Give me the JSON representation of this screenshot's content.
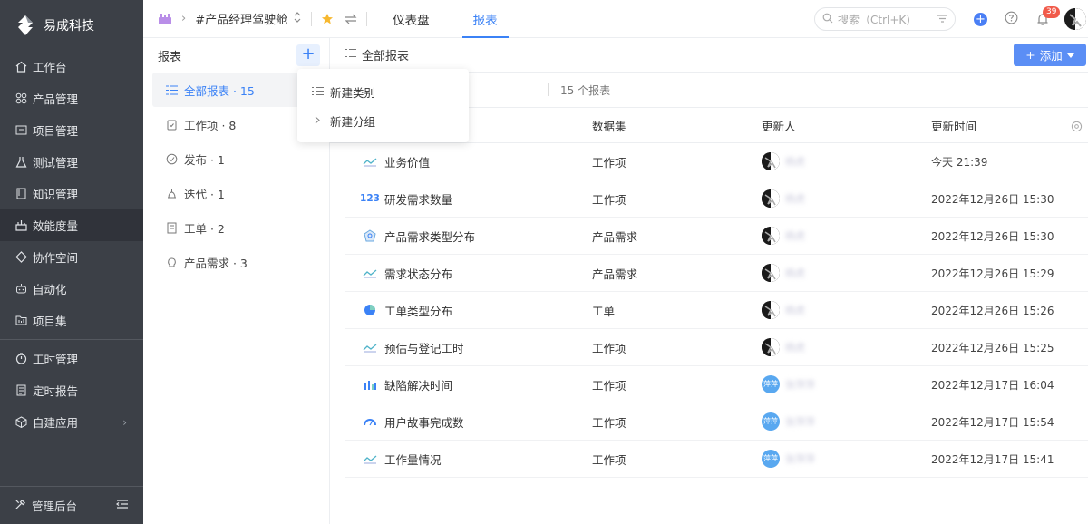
{
  "brand": {
    "name": "易成科技"
  },
  "nav": {
    "items": [
      {
        "label": "工作台",
        "icon": "home-icon"
      },
      {
        "label": "产品管理",
        "icon": "product-icon"
      },
      {
        "label": "项目管理",
        "icon": "project-icon"
      },
      {
        "label": "测试管理",
        "icon": "flask-icon"
      },
      {
        "label": "知识管理",
        "icon": "book-icon"
      },
      {
        "label": "效能度量",
        "icon": "measure-icon",
        "active": true
      },
      {
        "label": "协作空间",
        "icon": "collab-icon"
      },
      {
        "label": "自动化",
        "icon": "robot-icon"
      },
      {
        "label": "项目集",
        "icon": "folder-icon"
      }
    ],
    "items2": [
      {
        "label": "工时管理",
        "icon": "timer-icon"
      },
      {
        "label": "定时报告",
        "icon": "report-icon"
      },
      {
        "label": "自建应用",
        "icon": "cube-icon"
      }
    ],
    "admin": "管理后台"
  },
  "topbar": {
    "project": "#产品经理驾驶舱",
    "tabs": [
      "仪表盘",
      "报表"
    ],
    "active_tab": "报表",
    "search_placeholder": "搜索（Ctrl+K)",
    "notification_count": "39"
  },
  "side2": {
    "title": "报表",
    "items": [
      {
        "label": "全部报表 · 15",
        "icon": "list-icon",
        "active": true
      },
      {
        "label": "工作项 · 8",
        "icon": "clipboard-icon"
      },
      {
        "label": "发布 · 1",
        "icon": "check-circle-icon"
      },
      {
        "label": "迭代 · 1",
        "icon": "iteration-icon"
      },
      {
        "label": "工单 · 2",
        "icon": "ticket-icon"
      },
      {
        "label": "产品需求 · 3",
        "icon": "bulb-icon"
      }
    ]
  },
  "dropdown": {
    "items": [
      "新建类别",
      "新建分组"
    ]
  },
  "main": {
    "title": "全部报表",
    "add_label": "添加",
    "count": "15 个报表",
    "columns": [
      "数据集",
      "更新人",
      "更新时间"
    ],
    "rows": [
      {
        "name": "业务价值",
        "icon": "line-chart-icon",
        "dataset": "工作项",
        "user": "杨虎",
        "avatar": "dark",
        "time": "今天 21:39"
      },
      {
        "name": "研发需求数量",
        "icon": "number-icon",
        "dataset": "工作项",
        "user": "杨虎",
        "avatar": "dark",
        "time": "2022年12月26日 15:30"
      },
      {
        "name": "产品需求类型分布",
        "icon": "radar-icon",
        "dataset": "产品需求",
        "user": "杨虎",
        "avatar": "dark",
        "time": "2022年12月26日 15:30"
      },
      {
        "name": "需求状态分布",
        "icon": "line-chart-icon",
        "dataset": "产品需求",
        "user": "杨虎",
        "avatar": "dark",
        "time": "2022年12月26日 15:29"
      },
      {
        "name": "工单类型分布",
        "icon": "pie-chart-icon",
        "dataset": "工单",
        "user": "杨虎",
        "avatar": "dark",
        "time": "2022年12月26日 15:26"
      },
      {
        "name": "预估与登记工时",
        "icon": "line-chart-icon",
        "dataset": "工作项",
        "user": "杨虎",
        "avatar": "dark",
        "time": "2022年12月26日 15:25"
      },
      {
        "name": "缺陷解决时间",
        "icon": "bar-chart-icon",
        "dataset": "工作项",
        "user": "张萍萍",
        "avatar": "blue",
        "avatar_text": "萍萍",
        "time": "2022年12月17日 16:04"
      },
      {
        "name": "用户故事完成数",
        "icon": "gauge-icon",
        "dataset": "工作项",
        "user": "张萍萍",
        "avatar": "blue",
        "avatar_text": "萍萍",
        "time": "2022年12月17日 15:54"
      },
      {
        "name": "工作量情况",
        "icon": "line-chart-icon",
        "dataset": "工作项",
        "user": "张萍萍",
        "avatar": "blue",
        "avatar_text": "萍萍",
        "time": "2022年12月17日 15:41"
      }
    ]
  },
  "colors": {
    "accent": "#3b82f6",
    "nav_bg": "#3c4047",
    "badge": "#f15a4a"
  }
}
